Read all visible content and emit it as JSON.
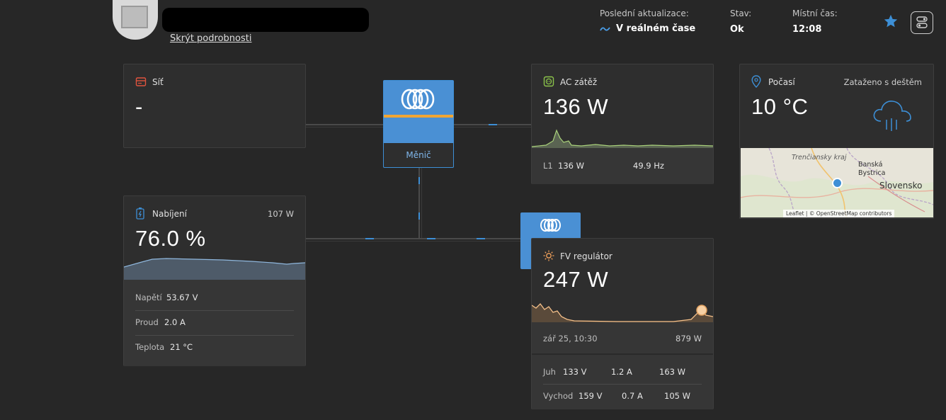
{
  "header": {
    "hide_details": "Skrýt podrobnosti",
    "last_update_label": "Poslední aktualizace:",
    "last_update_value": "V reálném čase",
    "status_label": "Stav:",
    "status_value": "Ok",
    "local_time_label": "Místní čas:",
    "local_time_value": "12:08"
  },
  "grid": {
    "title": "Síť",
    "value": "-"
  },
  "inverter": {
    "label": "Měnič"
  },
  "ac_load": {
    "title": "AC zátěž",
    "value": "136 W",
    "phase_label": "L1",
    "phase_power": "136 W",
    "frequency": "49.9 Hz"
  },
  "weather": {
    "title": "Počasí",
    "condition": "Zataženo s deštěm",
    "temperature": "10 °C",
    "map_labels": {
      "region": "Trenčiansky kraj",
      "city": "Banská Bystrica",
      "country": "Slovensko"
    },
    "map_attribution": "Leaflet | © OpenStreetMap contributors"
  },
  "battery": {
    "title": "Nabíjení",
    "power": "107 W",
    "soc": "76.0 %",
    "voltage_label": "Napětí",
    "voltage_value": "53.67 V",
    "current_label": "Proud",
    "current_value": "2.0 A",
    "temp_label": "Teplota",
    "temp_value": "21 °C"
  },
  "pv": {
    "title": "FV regulátor",
    "value": "247 W",
    "peak_time": "zář 25, 10:30",
    "peak_value": "879 W",
    "strings": [
      {
        "name": "Juh",
        "voltage": "133 V",
        "current": "1.2 A",
        "power": "163 W"
      },
      {
        "name": "Vychod",
        "voltage": "159 V",
        "current": "0.7 A",
        "power": "105 W"
      }
    ]
  },
  "colors": {
    "accent_blue": "#3d8fd6",
    "victron_orange": "#f0a534",
    "grid_red": "#e0533e",
    "load_green": "#8bc34a",
    "pv_orange": "#f5a35c"
  }
}
